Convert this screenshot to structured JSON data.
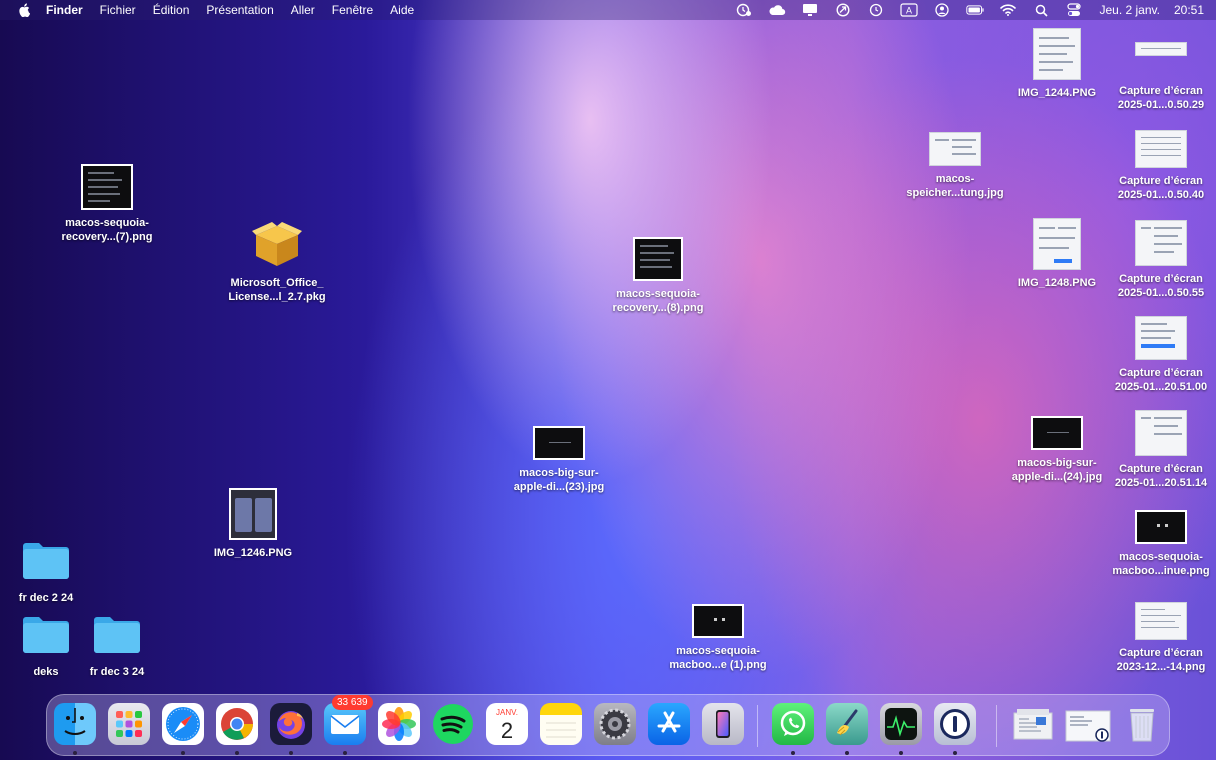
{
  "menubar": {
    "app_name": "Finder",
    "menus": [
      "Fichier",
      "Édition",
      "Présentation",
      "Aller",
      "Fenêtre",
      "Aide"
    ],
    "input_source": "A",
    "date": "Jeu. 2 janv.",
    "time": "20:51",
    "status_icons": [
      "screen-time-icon",
      "icloud-icon",
      "display-icon",
      "sync-icon",
      "time-machine-icon",
      "keyboard-input-icon",
      "user-icon",
      "battery-icon",
      "wifi-icon",
      "search-icon",
      "control-center-icon"
    ]
  },
  "desktop": {
    "left_items": [
      {
        "name": "macos-sequoia-\nrecovery...(7).png",
        "kind": "dark-screenshot"
      },
      {
        "name": "Microsoft_Office_\nLicense...l_2.7.pkg",
        "kind": "package"
      },
      {
        "name": "IMG_1246.PNG",
        "kind": "phone-screenshot"
      },
      {
        "name": "fr dec 2 24",
        "kind": "folder"
      },
      {
        "name": "deks",
        "kind": "folder"
      },
      {
        "name": "fr dec 3 24",
        "kind": "folder"
      }
    ],
    "center_items": [
      {
        "name": "macos-sequoia-\nrecovery...(8).png",
        "kind": "dark-screenshot"
      },
      {
        "name": "macos-big-sur-\napple-di...(23).jpg",
        "kind": "dark-screenshot"
      },
      {
        "name": "macos-sequoia-\nmacboo...e (1).png",
        "kind": "dark-screenshot"
      }
    ],
    "right_items": [
      {
        "name": "IMG_1244.PNG",
        "kind": "light-screenshot"
      },
      {
        "name": "macos-\nspeicher...tung.jpg",
        "kind": "light-screenshot"
      },
      {
        "name": "IMG_1248.PNG",
        "kind": "light-screenshot"
      },
      {
        "name": "macos-big-sur-\napple-di...(24).jpg",
        "kind": "dark-screenshot"
      },
      {
        "name": "Capture d’écran\n2025-01...0.50.29",
        "kind": "light-screenshot"
      },
      {
        "name": "Capture d’écran\n2025-01...0.50.40",
        "kind": "light-screenshot"
      },
      {
        "name": "Capture d’écran\n2025-01...0.50.55",
        "kind": "light-screenshot"
      },
      {
        "name": "Capture d’écran\n2025-01...20.51.00",
        "kind": "light-screenshot"
      },
      {
        "name": "Capture d’écran\n2025-01...20.51.14",
        "kind": "light-screenshot"
      },
      {
        "name": "macos-sequoia-\nmacboo...inue.png",
        "kind": "dark-screenshot"
      },
      {
        "name": "Capture d’écran\n2023-12...-14.png",
        "kind": "light-screenshot"
      }
    ]
  },
  "dock": {
    "apps": [
      {
        "name": "finder-icon",
        "running": true
      },
      {
        "name": "launchpad-icon",
        "running": false
      },
      {
        "name": "safari-icon",
        "running": true
      },
      {
        "name": "chrome-icon",
        "running": true
      },
      {
        "name": "firefox-icon",
        "running": true
      },
      {
        "name": "mail-icon",
        "running": true,
        "badge": "33 639"
      },
      {
        "name": "photos-icon",
        "running": false
      },
      {
        "name": "spotify-icon",
        "running": false
      },
      {
        "name": "calendar-icon",
        "running": false,
        "month": "JANV.",
        "day": "2"
      },
      {
        "name": "notes-icon",
        "running": false
      },
      {
        "name": "system-settings-icon",
        "running": false
      },
      {
        "name": "app-store-icon",
        "running": false
      },
      {
        "name": "iphone-mirroring-icon",
        "running": false
      },
      {
        "name": "whatsapp-icon",
        "running": true
      },
      {
        "name": "cleanmymac-icon",
        "running": true
      },
      {
        "name": "activity-monitor-icon",
        "running": true
      },
      {
        "name": "1password-icon",
        "running": true
      },
      {
        "name": "downloads-stack-icon",
        "running": false
      },
      {
        "name": "recent-document-icon",
        "running": false
      },
      {
        "name": "trash-icon",
        "running": false
      }
    ]
  },
  "colors": {
    "badge": "#ff3b30",
    "folder": "#5ec3f5"
  }
}
